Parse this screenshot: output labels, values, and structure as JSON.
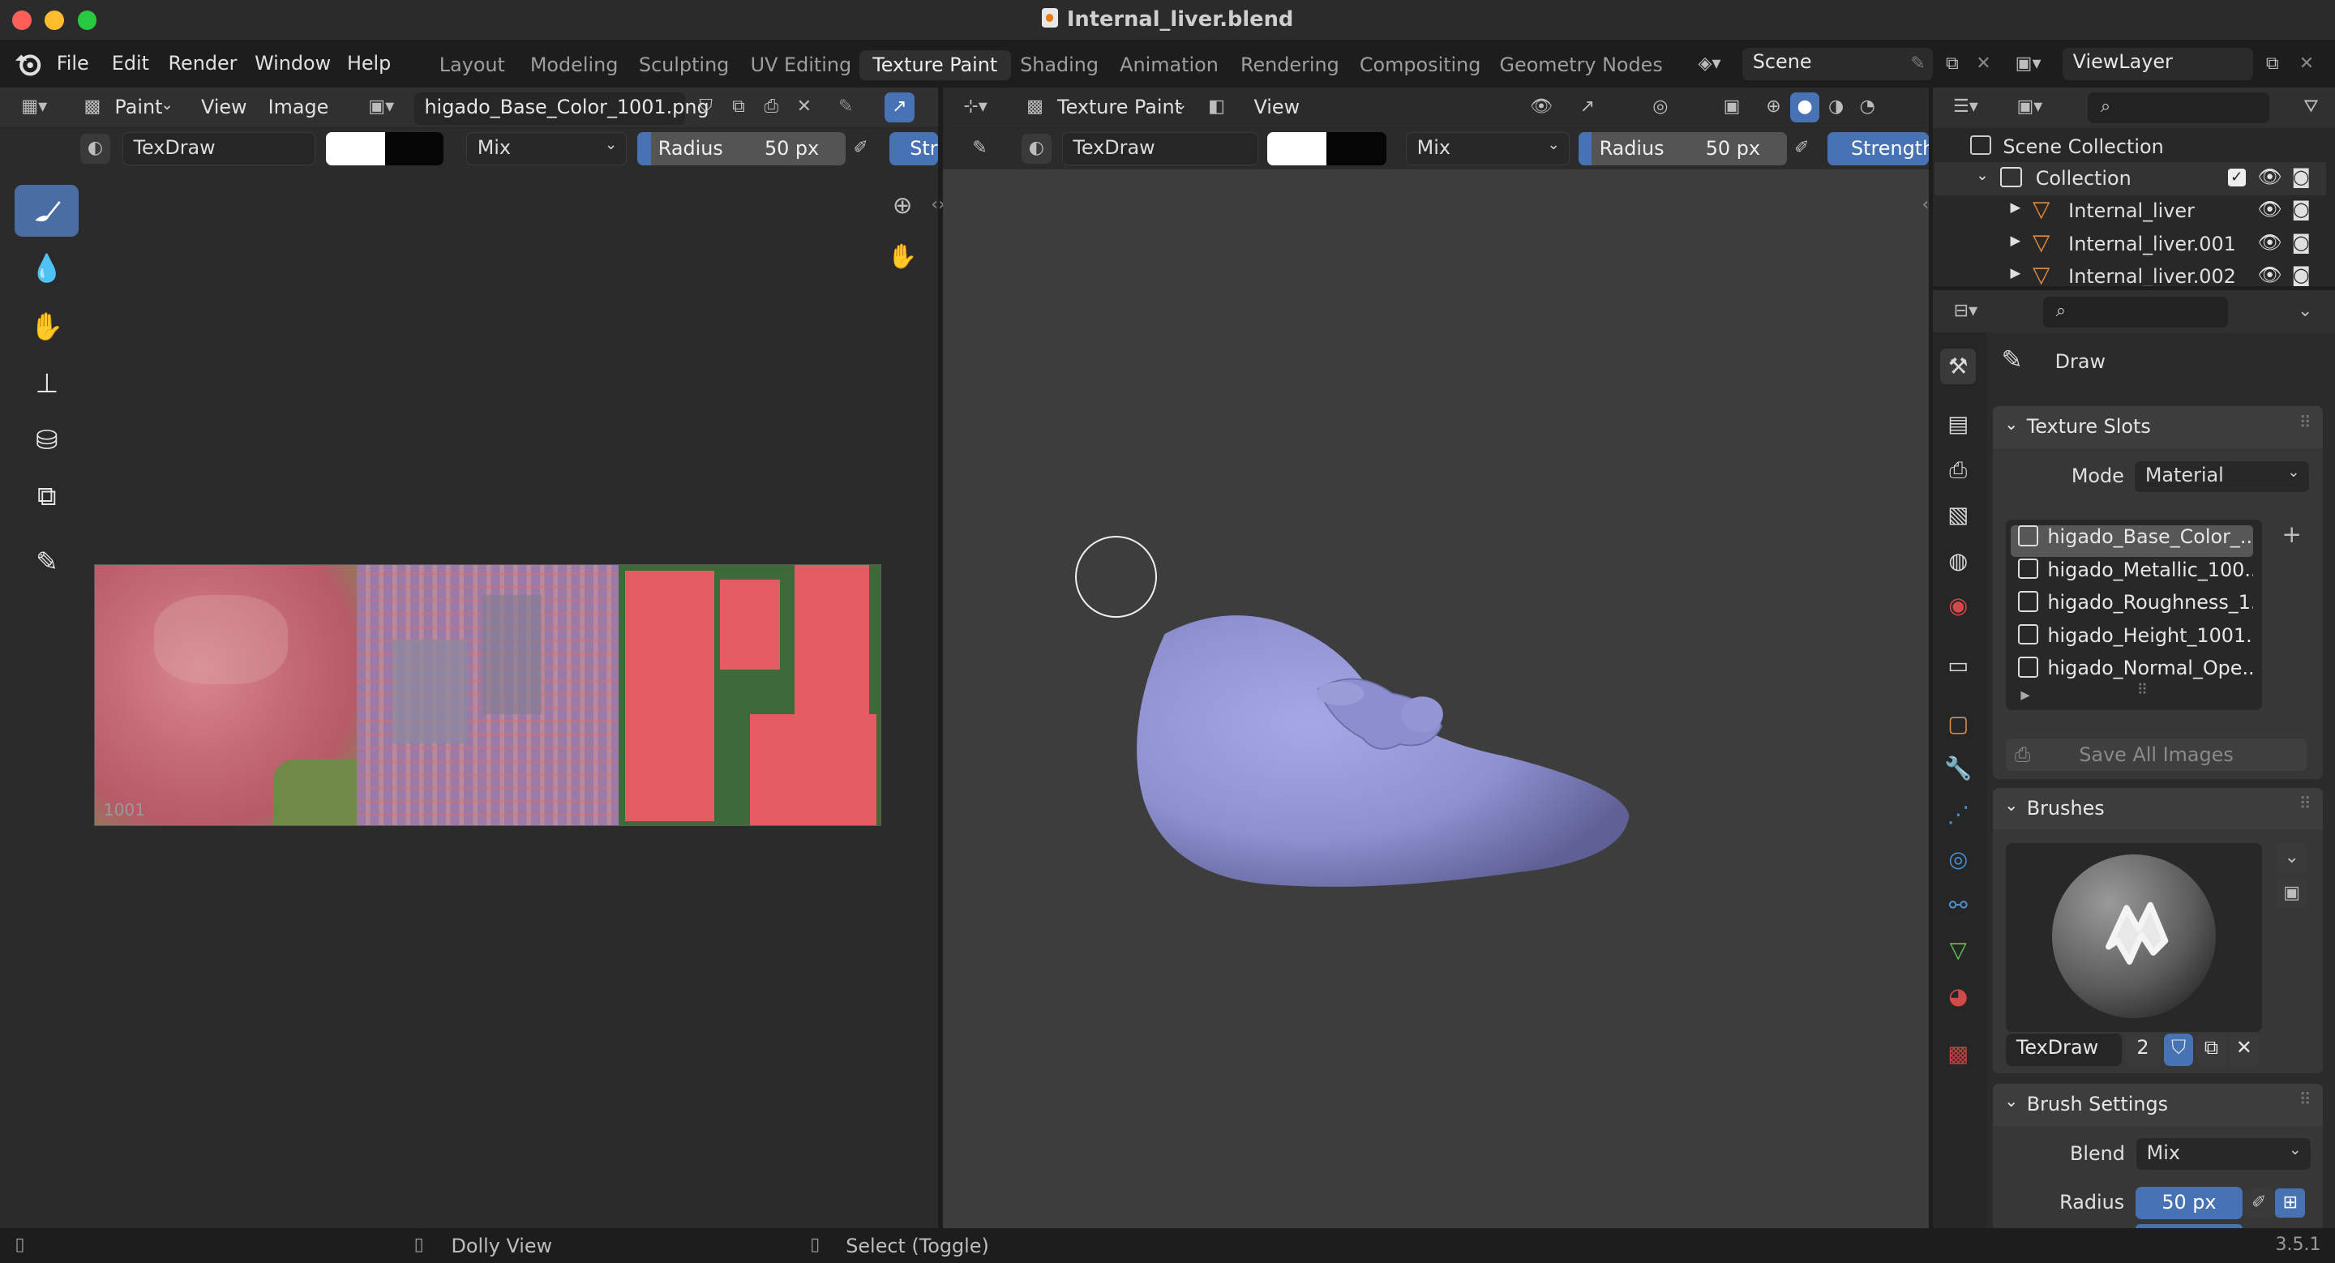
{
  "window": {
    "title": "Internal_liver.blend"
  },
  "menu": [
    "File",
    "Edit",
    "Render",
    "Window",
    "Help"
  ],
  "workspaces": [
    "Layout",
    "Modeling",
    "Sculpting",
    "UV Editing",
    "Texture Paint",
    "Shading",
    "Animation",
    "Rendering",
    "Compositing",
    "Geometry Nodes"
  ],
  "active_workspace": "Texture Paint",
  "scene": {
    "name": "Scene",
    "view_layer": "ViewLayer"
  },
  "image_editor": {
    "mode": "Paint",
    "menus": [
      "View",
      "Image"
    ],
    "image_name": "higado_Base_Color_1001.png",
    "brush": "TexDraw",
    "blend": "Mix",
    "radius_label": "Radius",
    "radius_value": "50 px",
    "strength_short": "Str",
    "udim_tile": "1001"
  },
  "viewport": {
    "mode": "Texture Paint",
    "menus": [
      "View"
    ],
    "brush": "TexDraw",
    "blend": "Mix",
    "radius_label": "Radius",
    "radius_value": "50 px",
    "strength_label": "Strength"
  },
  "outliner": {
    "root": "Scene Collection",
    "collection": "Collection",
    "objects": [
      "Internal_liver",
      "Internal_liver.001",
      "Internal_liver.002"
    ]
  },
  "properties": {
    "tool_name": "Draw",
    "texture_slots": {
      "title": "Texture Slots",
      "mode_label": "Mode",
      "mode_value": "Material",
      "slots": [
        "higado_Base_Color_...",
        "higado_Metallic_100...",
        "higado_Roughness_1...",
        "higado_Height_1001...",
        "higado_Normal_Ope..."
      ],
      "save_all": "Save All Images"
    },
    "brushes": {
      "title": "Brushes",
      "brush_name": "TexDraw",
      "users": "2"
    },
    "brush_settings": {
      "title": "Brush Settings",
      "blend_label": "Blend",
      "blend_value": "Mix",
      "radius_label": "Radius",
      "radius_value": "50 px"
    }
  },
  "statusbar": {
    "dolly": "Dolly View",
    "select": "Select (Toggle)",
    "version": "3.5.1"
  }
}
